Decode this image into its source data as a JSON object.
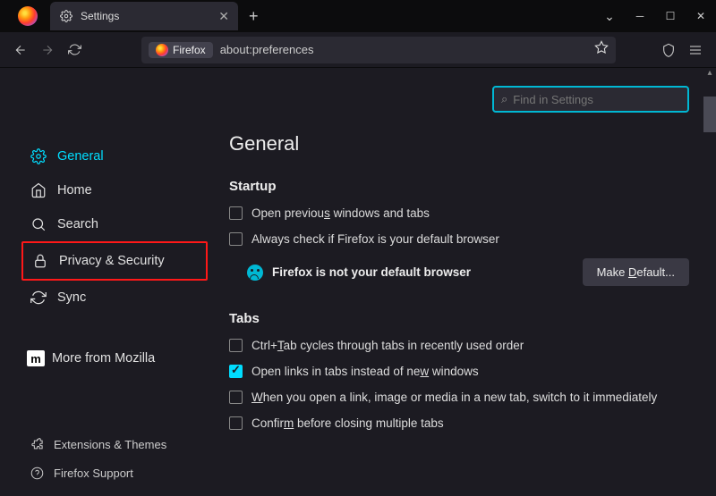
{
  "tab": {
    "title": "Settings"
  },
  "urlbar": {
    "identity": "Firefox",
    "url": "about:preferences"
  },
  "search": {
    "placeholder": "Find in Settings"
  },
  "sidebar": {
    "items": [
      {
        "label": "General"
      },
      {
        "label": "Home"
      },
      {
        "label": "Search"
      },
      {
        "label": "Privacy & Security"
      },
      {
        "label": "Sync"
      },
      {
        "label": "More from Mozilla"
      }
    ],
    "bottom": [
      {
        "label": "Extensions & Themes"
      },
      {
        "label": "Firefox Support"
      }
    ]
  },
  "main": {
    "heading": "General",
    "startup": {
      "title": "Startup",
      "prev": {
        "a": "Open previou",
        "u": "s",
        "b": " windows and tabs"
      },
      "always_check": "Always check if Firefox is your default browser",
      "not_default": "Firefox is not your default browser",
      "make_default": {
        "a": "Make ",
        "u": "D",
        "b": "efault..."
      }
    },
    "tabs": {
      "title": "Tabs",
      "ctrl": {
        "a": "Ctrl+",
        "u": "T",
        "b": "ab cycles through tabs in recently used order"
      },
      "open_links": {
        "a": "Open links in tabs instead of ne",
        "u": "w",
        "b": " windows"
      },
      "switch": {
        "a": "",
        "u": "W",
        "b": "hen you open a link, image or media in a new tab, switch to it immediately"
      },
      "confirm": {
        "a": "Confir",
        "u": "m",
        "b": " before closing multiple tabs"
      }
    }
  }
}
